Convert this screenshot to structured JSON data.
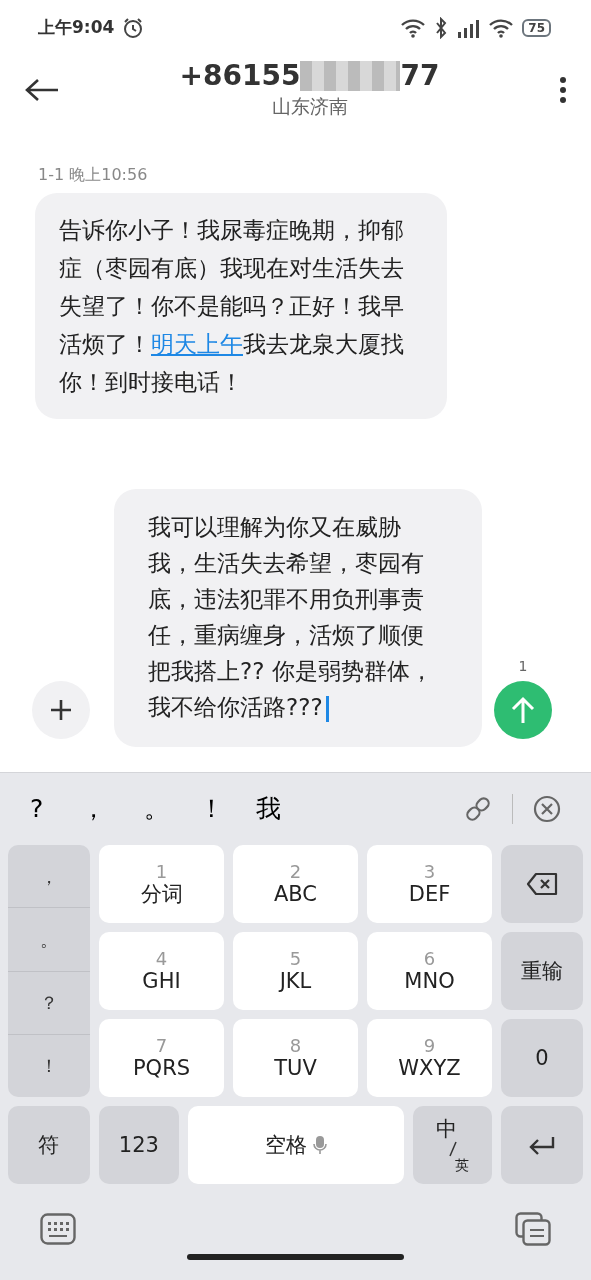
{
  "status_bar": {
    "time": "上午9:04",
    "battery": "75"
  },
  "header": {
    "number_start": "+86155",
    "number_end": "77",
    "location": "山东济南"
  },
  "messages": [
    {
      "kind": "incoming",
      "timestamp": "1-1 晚上10:56",
      "text_before": "告诉你小子！我尿毒症晚期，抑郁症（枣园有底）我现在对生活失去失望了！你不是能吗？正好！我早活烦了！",
      "link": "明天上午",
      "text_after": "我去龙泉大厦找你！到时接电话！"
    }
  ],
  "compose": {
    "text": "我可以理解为你又在威胁我，生活失去希望，枣园有底，违法犯罪不用负刑事责任，重病缠身，活烦了顺便把我搭上?? 你是弱势群体，我不给你活路???",
    "send_count": "1"
  },
  "keyboard": {
    "candidates": [
      "?",
      "，",
      "。",
      "！",
      "我"
    ],
    "side_keys": [
      "，",
      "。",
      "？",
      "！"
    ],
    "keys": [
      {
        "digit": "1",
        "label": "分词"
      },
      {
        "digit": "2",
        "label": "ABC"
      },
      {
        "digit": "3",
        "label": "DEF"
      },
      {
        "digit": "4",
        "label": "GHI"
      },
      {
        "digit": "5",
        "label": "JKL"
      },
      {
        "digit": "6",
        "label": "MNO"
      },
      {
        "digit": "7",
        "label": "PQRS"
      },
      {
        "digit": "8",
        "label": "TUV"
      },
      {
        "digit": "9",
        "label": "WXYZ"
      }
    ],
    "reenter": "重输",
    "zero": "0",
    "symbols": "符",
    "numbers": "123",
    "space": "空格",
    "lang_main": "中",
    "lang_sub": "英"
  }
}
